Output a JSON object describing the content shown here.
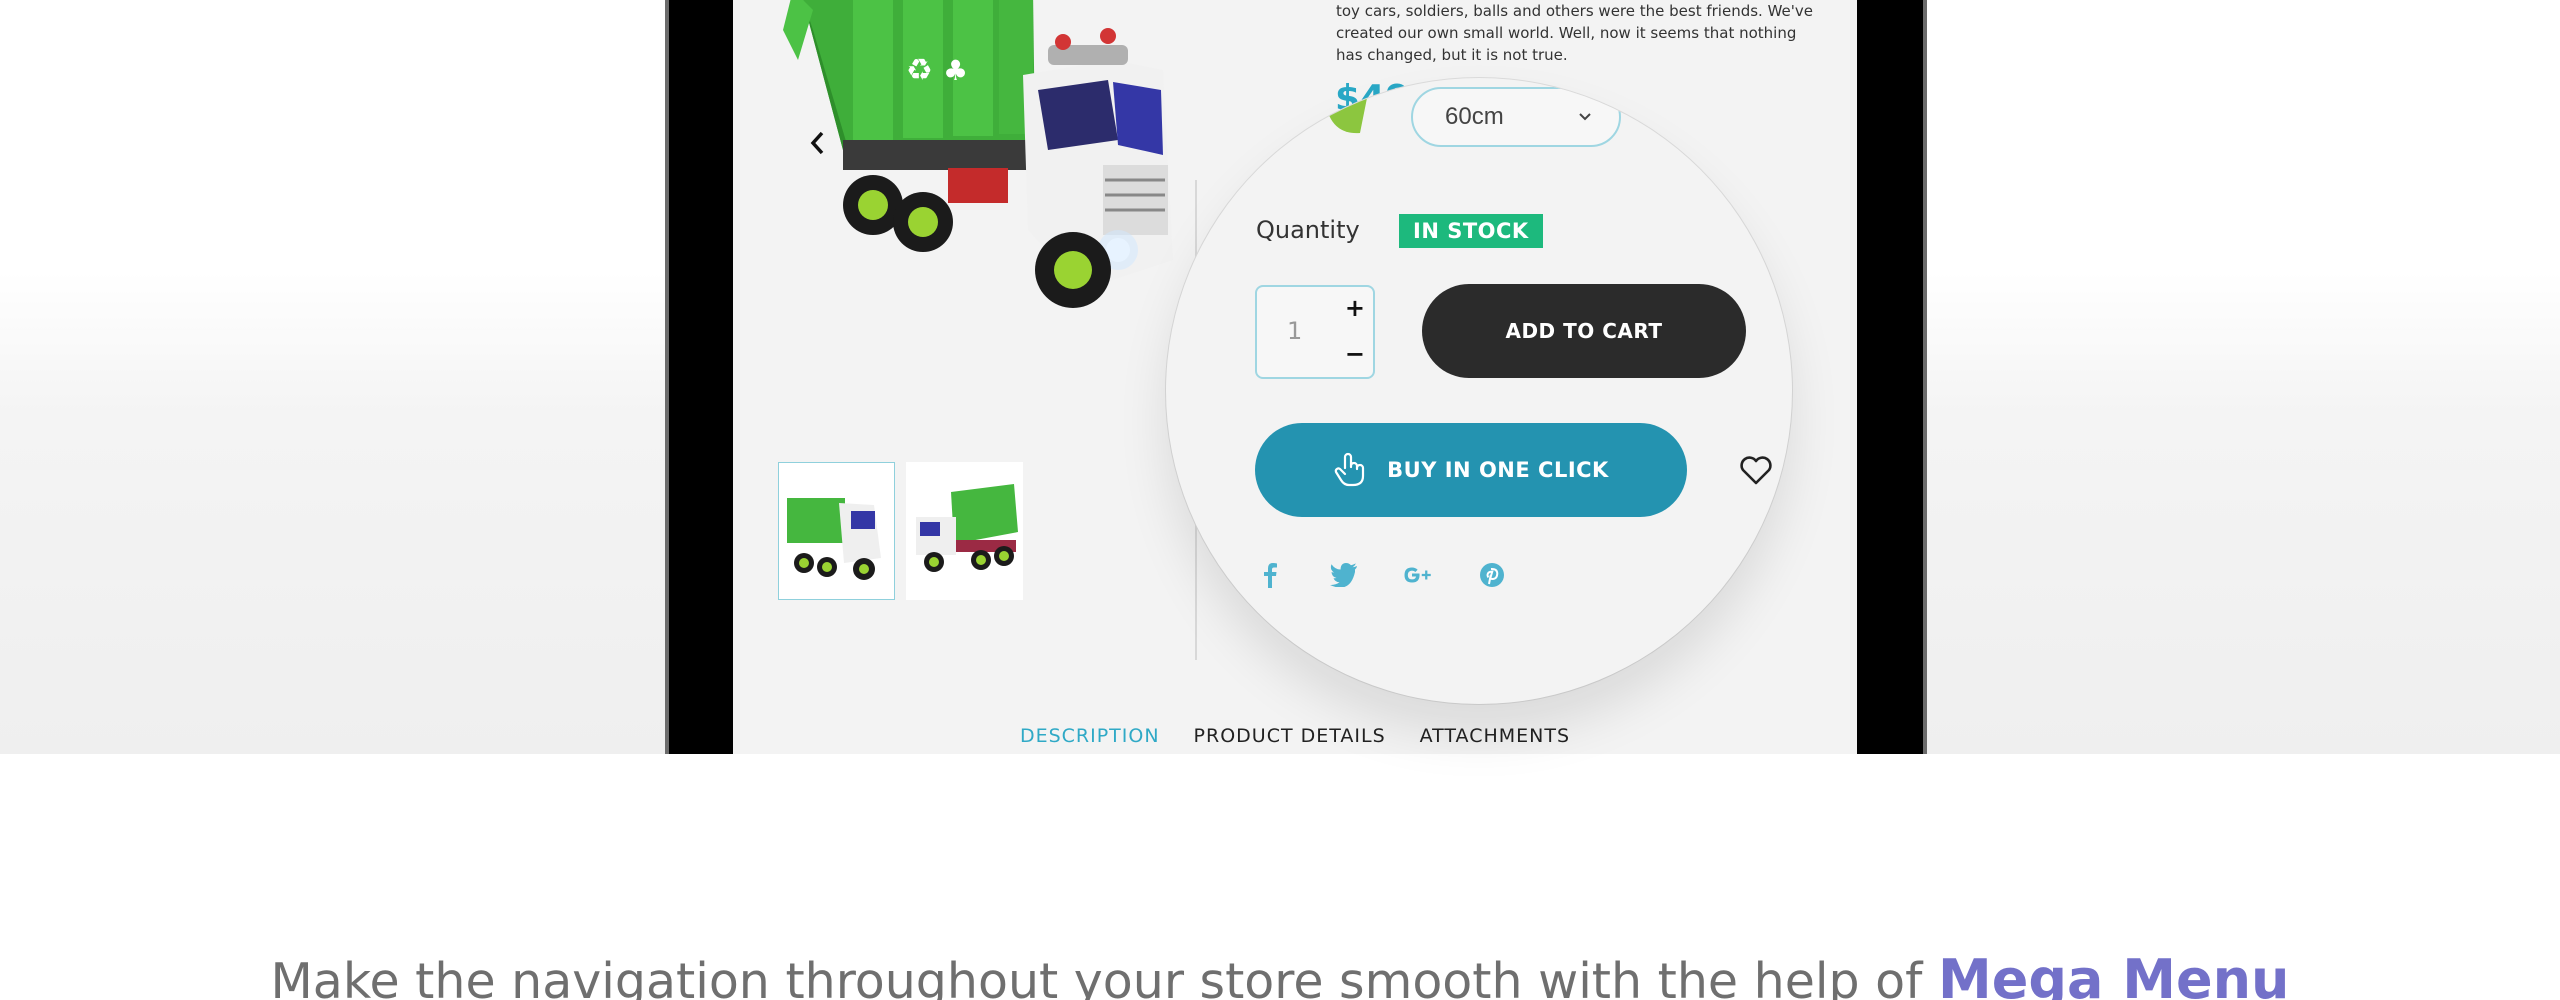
{
  "product": {
    "description_lines": [
      "toy cars, soldiers, balls and others were the best friends. We've",
      "created our own small world. Well, now it seems that nothing",
      "has changed, but it is not true."
    ],
    "price_peek": "$49",
    "size_selected": "60cm",
    "quantity_label": "Quantity",
    "stock_status": "IN STOCK",
    "quantity_value": "1",
    "qty_plus": "+",
    "qty_minus": "−",
    "add_to_cart_label": "ADD TO CART",
    "buy_one_click_label": "BUY IN ONE CLICK"
  },
  "social_icons": [
    "facebook-icon",
    "twitter-icon",
    "google-plus-icon",
    "pinterest-icon"
  ],
  "tabs": [
    {
      "label": "DESCRIPTION",
      "active": true
    },
    {
      "label": "PRODUCT DETAILS",
      "active": false
    },
    {
      "label": "ATTACHMENTS",
      "active": false
    }
  ],
  "headline": {
    "text": "Make the navigation throughout your store smooth with the help of ",
    "accent": "Mega Menu"
  },
  "colors": {
    "accent_blue": "#2493b0",
    "stock_green": "#1db97d",
    "headline_accent": "#7371c9",
    "tab_active": "#2fa9c6"
  }
}
